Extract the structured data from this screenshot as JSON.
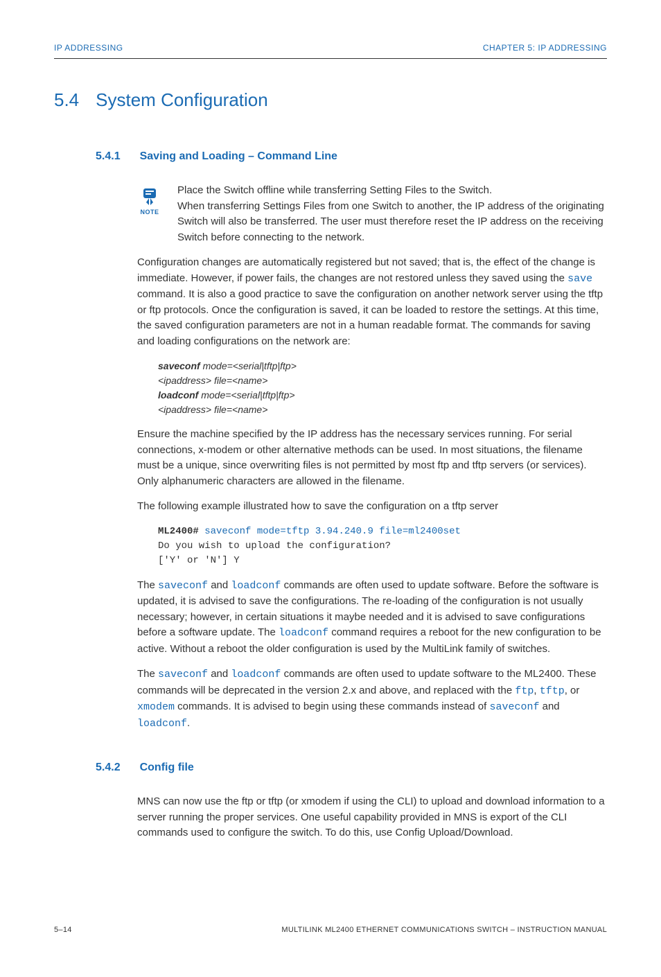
{
  "header": {
    "left": "IP ADDRESSING",
    "right": "CHAPTER 5: IP ADDRESSING"
  },
  "section": {
    "number": "5.4",
    "title": "System Configuration"
  },
  "sub541": {
    "number": "5.4.1",
    "title": "Saving and Loading – Command Line",
    "note_label": "NOTE",
    "note_p1": "Place the Switch offline while transferring Setting Files to the Switch.",
    "note_p2": "When transferring Settings Files from one Switch to another, the IP address of the originating Switch will also be transferred. The user must therefore reset the IP address on the receiving Switch before connecting to the network.",
    "p1a": "Configuration changes are automatically registered but not saved; that is, the effect of the change is immediate. However, if power fails, the changes are not restored unless they saved using the ",
    "p1_cmd": "save",
    "p1b": " command. It is also a good practice to save the configuration on another network server using the tftp or ftp protocols. Once the configuration is saved, it can be loaded to restore the settings. At this time, the saved configuration parameters are not in a human readable format. The commands for saving and loading configurations on the network are:",
    "cmd_save_b": "saveconf",
    "cmd_save_i": " mode=<serial|tftp|ftp>",
    "cmd_save_i2": "<ipaddress> file=<name>",
    "cmd_load_b": "loadconf",
    "cmd_load_i": " mode=<serial|tftp|ftp>",
    "cmd_load_i2": "<ipaddress> file=<name>",
    "p2": "Ensure the machine specified by the IP address has the necessary services running. For serial connections, x-modem or other alternative methods can be used. In most situations, the filename must be a unique, since overwriting files is not permitted by most ftp and tftp servers (or services). Only alphanumeric characters are allowed in the filename.",
    "p3": "The following example illustrated how to save the configuration on a tftp server",
    "term_prompt": "ML2400#",
    "term_cmd": " saveconf mode=tftp 3.94.240.9 file=ml2400set",
    "term_line2": "Do you wish to upload the configuration?",
    "term_line3": "['Y' or 'N'] Y",
    "p4a": "The ",
    "p4_c1": "saveconf",
    "p4b": " and ",
    "p4_c2": "loadconf",
    "p4c": " commands are often used to update software. Before the software is updated, it is advised to save the configurations. The re-loading of the configuration is not usually necessary; however, in certain situations it maybe needed and it is advised to save configurations before a software update. The ",
    "p4_c3": "loadconf",
    "p4d": " command requires a reboot for the new configuration to be active. Without a reboot the older configuration is used by the MultiLink family of switches.",
    "p5a": "The ",
    "p5_c1": "saveconf",
    "p5b": " and ",
    "p5_c2": "loadconf",
    "p5c": " commands are often used to update software to the ML2400. These commands will be deprecated in the version 2.x and above, and replaced with the ",
    "p5_c3": "ftp",
    "p5d": ", ",
    "p5_c4": "tftp",
    "p5e": ", or ",
    "p5_c5": "xmodem",
    "p5f": " commands. It is advised to begin using these commands instead of ",
    "p5_c6": "saveconf",
    "p5g": " and ",
    "p5_c7": "loadconf",
    "p5h": "."
  },
  "sub542": {
    "number": "5.4.2",
    "title": "Config file",
    "p1": "MNS can now use the ftp or tftp (or xmodem if using the CLI) to upload and download information to a server running the proper services. One useful capability provided in MNS is export of the CLI commands used to configure the switch. To do this, use Config Upload/Download."
  },
  "footer": {
    "left": "5–14",
    "right": "MULTILINK ML2400 ETHERNET COMMUNICATIONS SWITCH – INSTRUCTION MANUAL"
  }
}
